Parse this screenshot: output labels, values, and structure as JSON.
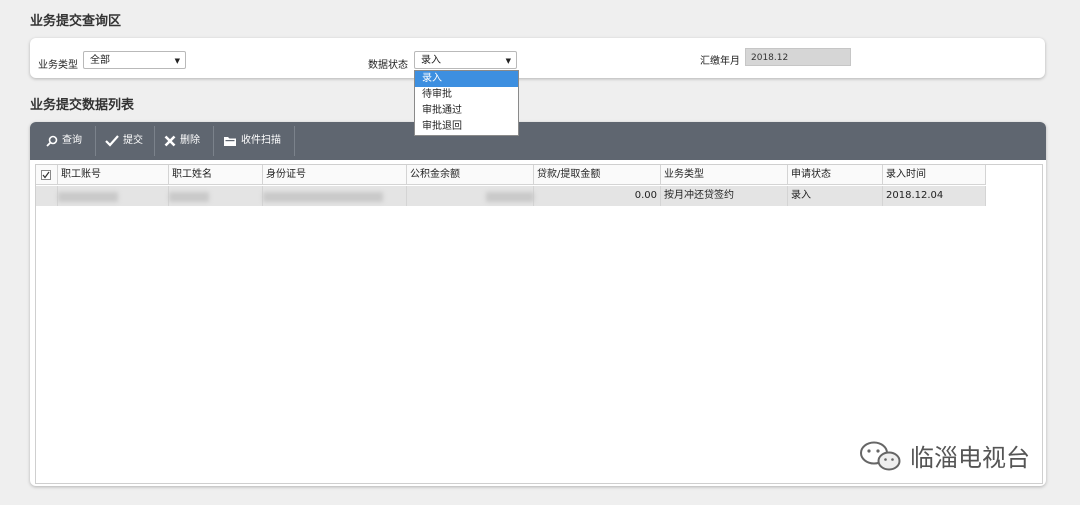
{
  "query_section": {
    "title": "业务提交查询区",
    "business_type_label": "业务类型",
    "business_type_value": "全部",
    "data_status_label": "数据状态",
    "data_status_value": "录入",
    "pay_month_label": "汇缴年月",
    "pay_month_value": "2018.12",
    "status_options": [
      "录入",
      "待审批",
      "审批通过",
      "审批退回"
    ]
  },
  "list_section": {
    "title": "业务提交数据列表",
    "toolbar": {
      "query_label": "查询",
      "submit_label": "提交",
      "delete_label": "删除",
      "scan_label": "收件扫描"
    },
    "columns": [
      "职工账号",
      "职工姓名",
      "身份证号",
      "公积金余额",
      "贷款/提取金额",
      "业务类型",
      "申请状态",
      "录入时间"
    ],
    "rows": [
      {
        "loan_amount": "0.00",
        "business_type": "按月冲还贷签约",
        "status": "录入",
        "entry_time": "2018.12.04"
      }
    ]
  },
  "watermark": {
    "text": "临淄电视台"
  }
}
